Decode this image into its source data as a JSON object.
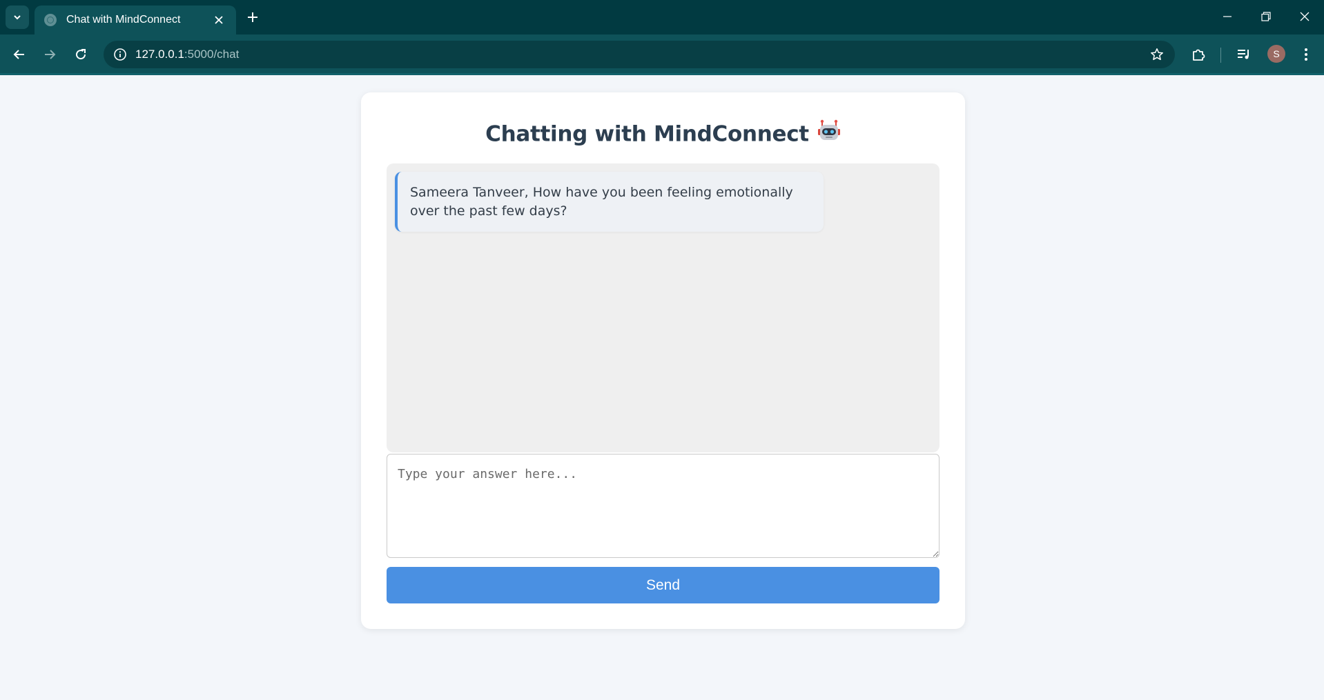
{
  "browser": {
    "tab_title": "Chat with MindConnect",
    "url_host": "127.0.0.1",
    "url_path": ":5000/chat",
    "profile_initial": "S"
  },
  "icons": {
    "tab_search": "chevron-down-icon",
    "favicon": "globe-icon",
    "tab_close": "close-icon",
    "new_tab": "plus-icon",
    "back": "arrow-left-icon",
    "forward": "arrow-right-icon",
    "reload": "reload-icon",
    "site_info": "info-icon",
    "bookmark": "star-icon",
    "extensions": "puzzle-icon",
    "media": "media-queue-icon",
    "menu": "kebab-menu-icon",
    "title_emoji": "robot-icon"
  },
  "page": {
    "title": "Chatting with MindConnect",
    "messages": [
      {
        "sender": "bot",
        "text": "Sameera Tanveer, How have you been feeling emotionally over the past few days?"
      }
    ],
    "answer_placeholder": "Type your answer here...",
    "answer_value": "",
    "send_label": "Send"
  },
  "colors": {
    "chrome_dark": "#013a41",
    "chrome_toolbar": "#0e5259",
    "page_bg": "#f3f6fa",
    "accent": "#4a90e2",
    "title_text": "#2c3e50"
  }
}
